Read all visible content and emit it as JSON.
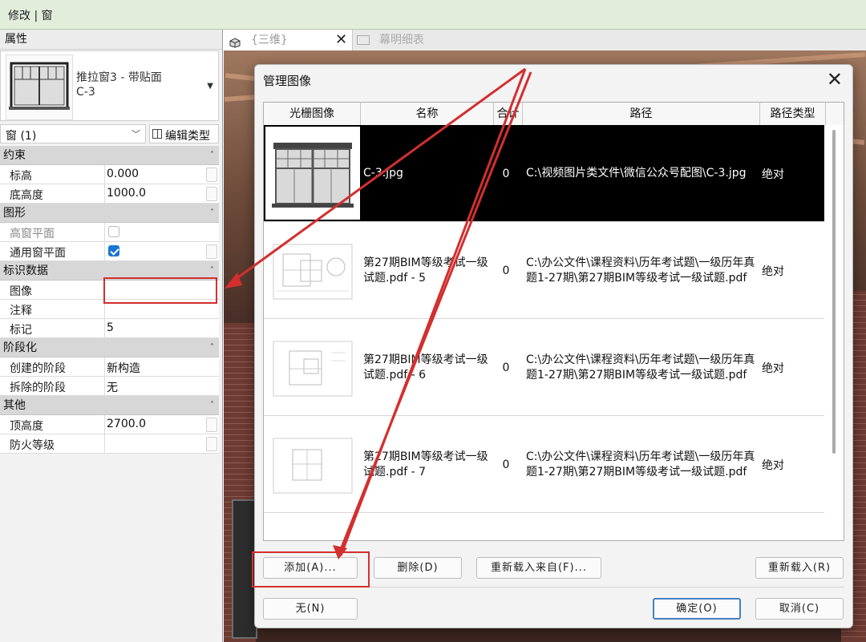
{
  "ribbon": {
    "title": "修改 | 窗"
  },
  "properties": {
    "header": "属性",
    "type_name_line1": "推拉窗3 - 带贴面",
    "type_name_line2": "C-3",
    "instance_selector": "窗 (1)",
    "edit_type_label": "编辑类型",
    "sections": [
      {
        "title": "约束",
        "rows": [
          {
            "key": "标高",
            "value": "0.000"
          },
          {
            "key": "底高度",
            "value": "1000.0"
          }
        ]
      },
      {
        "title": "图形",
        "rows": [
          {
            "key": "高窗平面",
            "checked": false
          },
          {
            "key": "通用窗平面",
            "checked": true
          }
        ]
      },
      {
        "title": "标识数据",
        "rows": [
          {
            "key": "图像",
            "value": ""
          },
          {
            "key": "注释",
            "value": ""
          },
          {
            "key": "标记",
            "value": "5"
          }
        ]
      },
      {
        "title": "阶段化",
        "rows": [
          {
            "key": "创建的阶段",
            "value": "新构造"
          },
          {
            "key": "拆除的阶段",
            "value": "无"
          }
        ]
      },
      {
        "title": "其他",
        "rows": [
          {
            "key": "顶高度",
            "value": "2700.0"
          },
          {
            "key": "防火等级",
            "value": ""
          }
        ]
      }
    ]
  },
  "tabs": {
    "active_label": "{三维}",
    "inactive_label": "幕明细表"
  },
  "dialog": {
    "title": "管理图像",
    "columns": [
      "光栅图像",
      "名称",
      "合计",
      "路径",
      "路径类型"
    ],
    "rows": [
      {
        "name": "C-3.jpg",
        "count": "0",
        "path": "C:\\视频图片类文件\\微信公众号配图\\C-3.jpg",
        "path_type": "绝对",
        "selected": true,
        "thumb": "window-photo"
      },
      {
        "name": "第27期BIM等级考试一级试题.pdf - 5",
        "count": "0",
        "path": "C:\\办公文件\\课程资料\\历年考试题\\一级历年真题1-27期\\第27期BIM等级考试一级试题.pdf",
        "path_type": "绝对",
        "selected": false,
        "thumb": "floorplan"
      },
      {
        "name": "第27期BIM等级考试一级试题.pdf - 6",
        "count": "0",
        "path": "C:\\办公文件\\课程资料\\历年考试题\\一级历年真题1-27期\\第27期BIM等级考试一级试题.pdf",
        "path_type": "绝对",
        "selected": false,
        "thumb": "floorplan"
      },
      {
        "name": "第27期BIM等级考试一级试题.pdf - 7",
        "count": "0",
        "path": "C:\\办公文件\\课程资料\\历年考试题\\一级历年真题1-27期\\第27期BIM等级考试一级试题.pdf",
        "path_type": "绝对",
        "selected": false,
        "thumb": "floorplan"
      }
    ],
    "buttons": {
      "add": "添加(A)...",
      "delete": "删除(D)",
      "reload_from": "重新载入来自(F)...",
      "reload": "重新载入(R)",
      "none": "无(N)",
      "ok": "确定(O)",
      "cancel": "取消(C)"
    }
  },
  "colors": {
    "annotation": "#d32f2f",
    "selected_row": "#000000",
    "ribbon": "#e3eddb",
    "checkbox_on": "#1976d2"
  }
}
